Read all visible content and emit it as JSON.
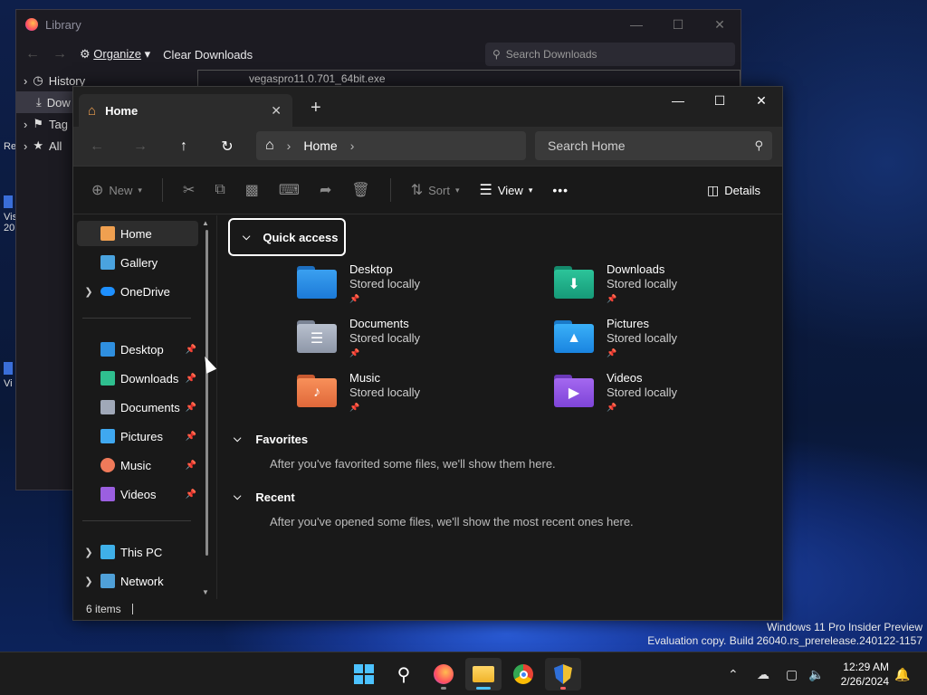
{
  "library": {
    "title": "Library",
    "toolbar": {
      "organize": "Organize",
      "clear_downloads": "Clear Downloads",
      "search_placeholder": "Search Downloads"
    },
    "tree": [
      "History",
      "Dow",
      "Tag",
      "All"
    ],
    "list_item": "vegaspro11.0.701_64bit.exe"
  },
  "desktop_icons": [
    "Re",
    "Vis",
    "20",
    "Vi"
  ],
  "explorer": {
    "tab_title": "Home",
    "address": {
      "location": "Home"
    },
    "search_placeholder": "Search Home",
    "commands": {
      "new": "New",
      "sort": "Sort",
      "view": "View",
      "more": "•••",
      "details": "Details"
    },
    "sidebar": {
      "top": [
        {
          "label": "Home",
          "icon": "home-icon",
          "color": "#f0a050",
          "selected": true
        },
        {
          "label": "Gallery",
          "icon": "gallery-icon",
          "color": "#4aa3df"
        },
        {
          "label": "OneDrive",
          "icon": "onedrive-icon",
          "color": "#1e90ff",
          "expandable": true
        }
      ],
      "pinned": [
        {
          "label": "Desktop",
          "icon": "desktop-folder-icon",
          "color": "#2f8fdf"
        },
        {
          "label": "Downloads",
          "icon": "downloads-icon",
          "color": "#2fbf8f"
        },
        {
          "label": "Documents",
          "icon": "documents-icon",
          "color": "#a0a8b8"
        },
        {
          "label": "Pictures",
          "icon": "pictures-icon",
          "color": "#3fa8f0"
        },
        {
          "label": "Music",
          "icon": "music-icon",
          "color": "#f07a5a"
        },
        {
          "label": "Videos",
          "icon": "videos-icon",
          "color": "#9b5fe0"
        }
      ],
      "bottom": [
        {
          "label": "This PC",
          "icon": "this-pc-icon",
          "color": "#3fb0e8"
        },
        {
          "label": "Network",
          "icon": "network-icon",
          "color": "#4fa0d8"
        }
      ]
    },
    "quick_access": {
      "header": "Quick access",
      "items": [
        {
          "name": "Desktop",
          "status": "Stored locally",
          "color": "#2f8fdf",
          "glyph": ""
        },
        {
          "name": "Downloads",
          "status": "Stored locally",
          "color": "#1fae8a",
          "glyph": "⬇"
        },
        {
          "name": "Documents",
          "status": "Stored locally",
          "color": "#9aa3b3",
          "glyph": "☰"
        },
        {
          "name": "Pictures",
          "status": "Stored locally",
          "color": "#2a9ae8",
          "glyph": "▲"
        },
        {
          "name": "Music",
          "status": "Stored locally",
          "color": "#f07a4a",
          "glyph": "♪"
        },
        {
          "name": "Videos",
          "status": "Stored locally",
          "color": "#8b52d8",
          "glyph": "▶"
        }
      ]
    },
    "favorites": {
      "header": "Favorites",
      "message": "After you've favorited some files, we'll show them here."
    },
    "recent": {
      "header": "Recent",
      "message": "After you've opened some files, we'll show the most recent ones here."
    },
    "status": {
      "items": "6 items"
    }
  },
  "watermark": {
    "line1": "Windows 11 Pro Insider Preview",
    "line2": "Evaluation copy. Build 26040.rs_prerelease.240122-1157"
  },
  "taskbar": {
    "time": "12:29 AM",
    "date": "2/26/2024",
    "accent": "#4cc2ff"
  }
}
